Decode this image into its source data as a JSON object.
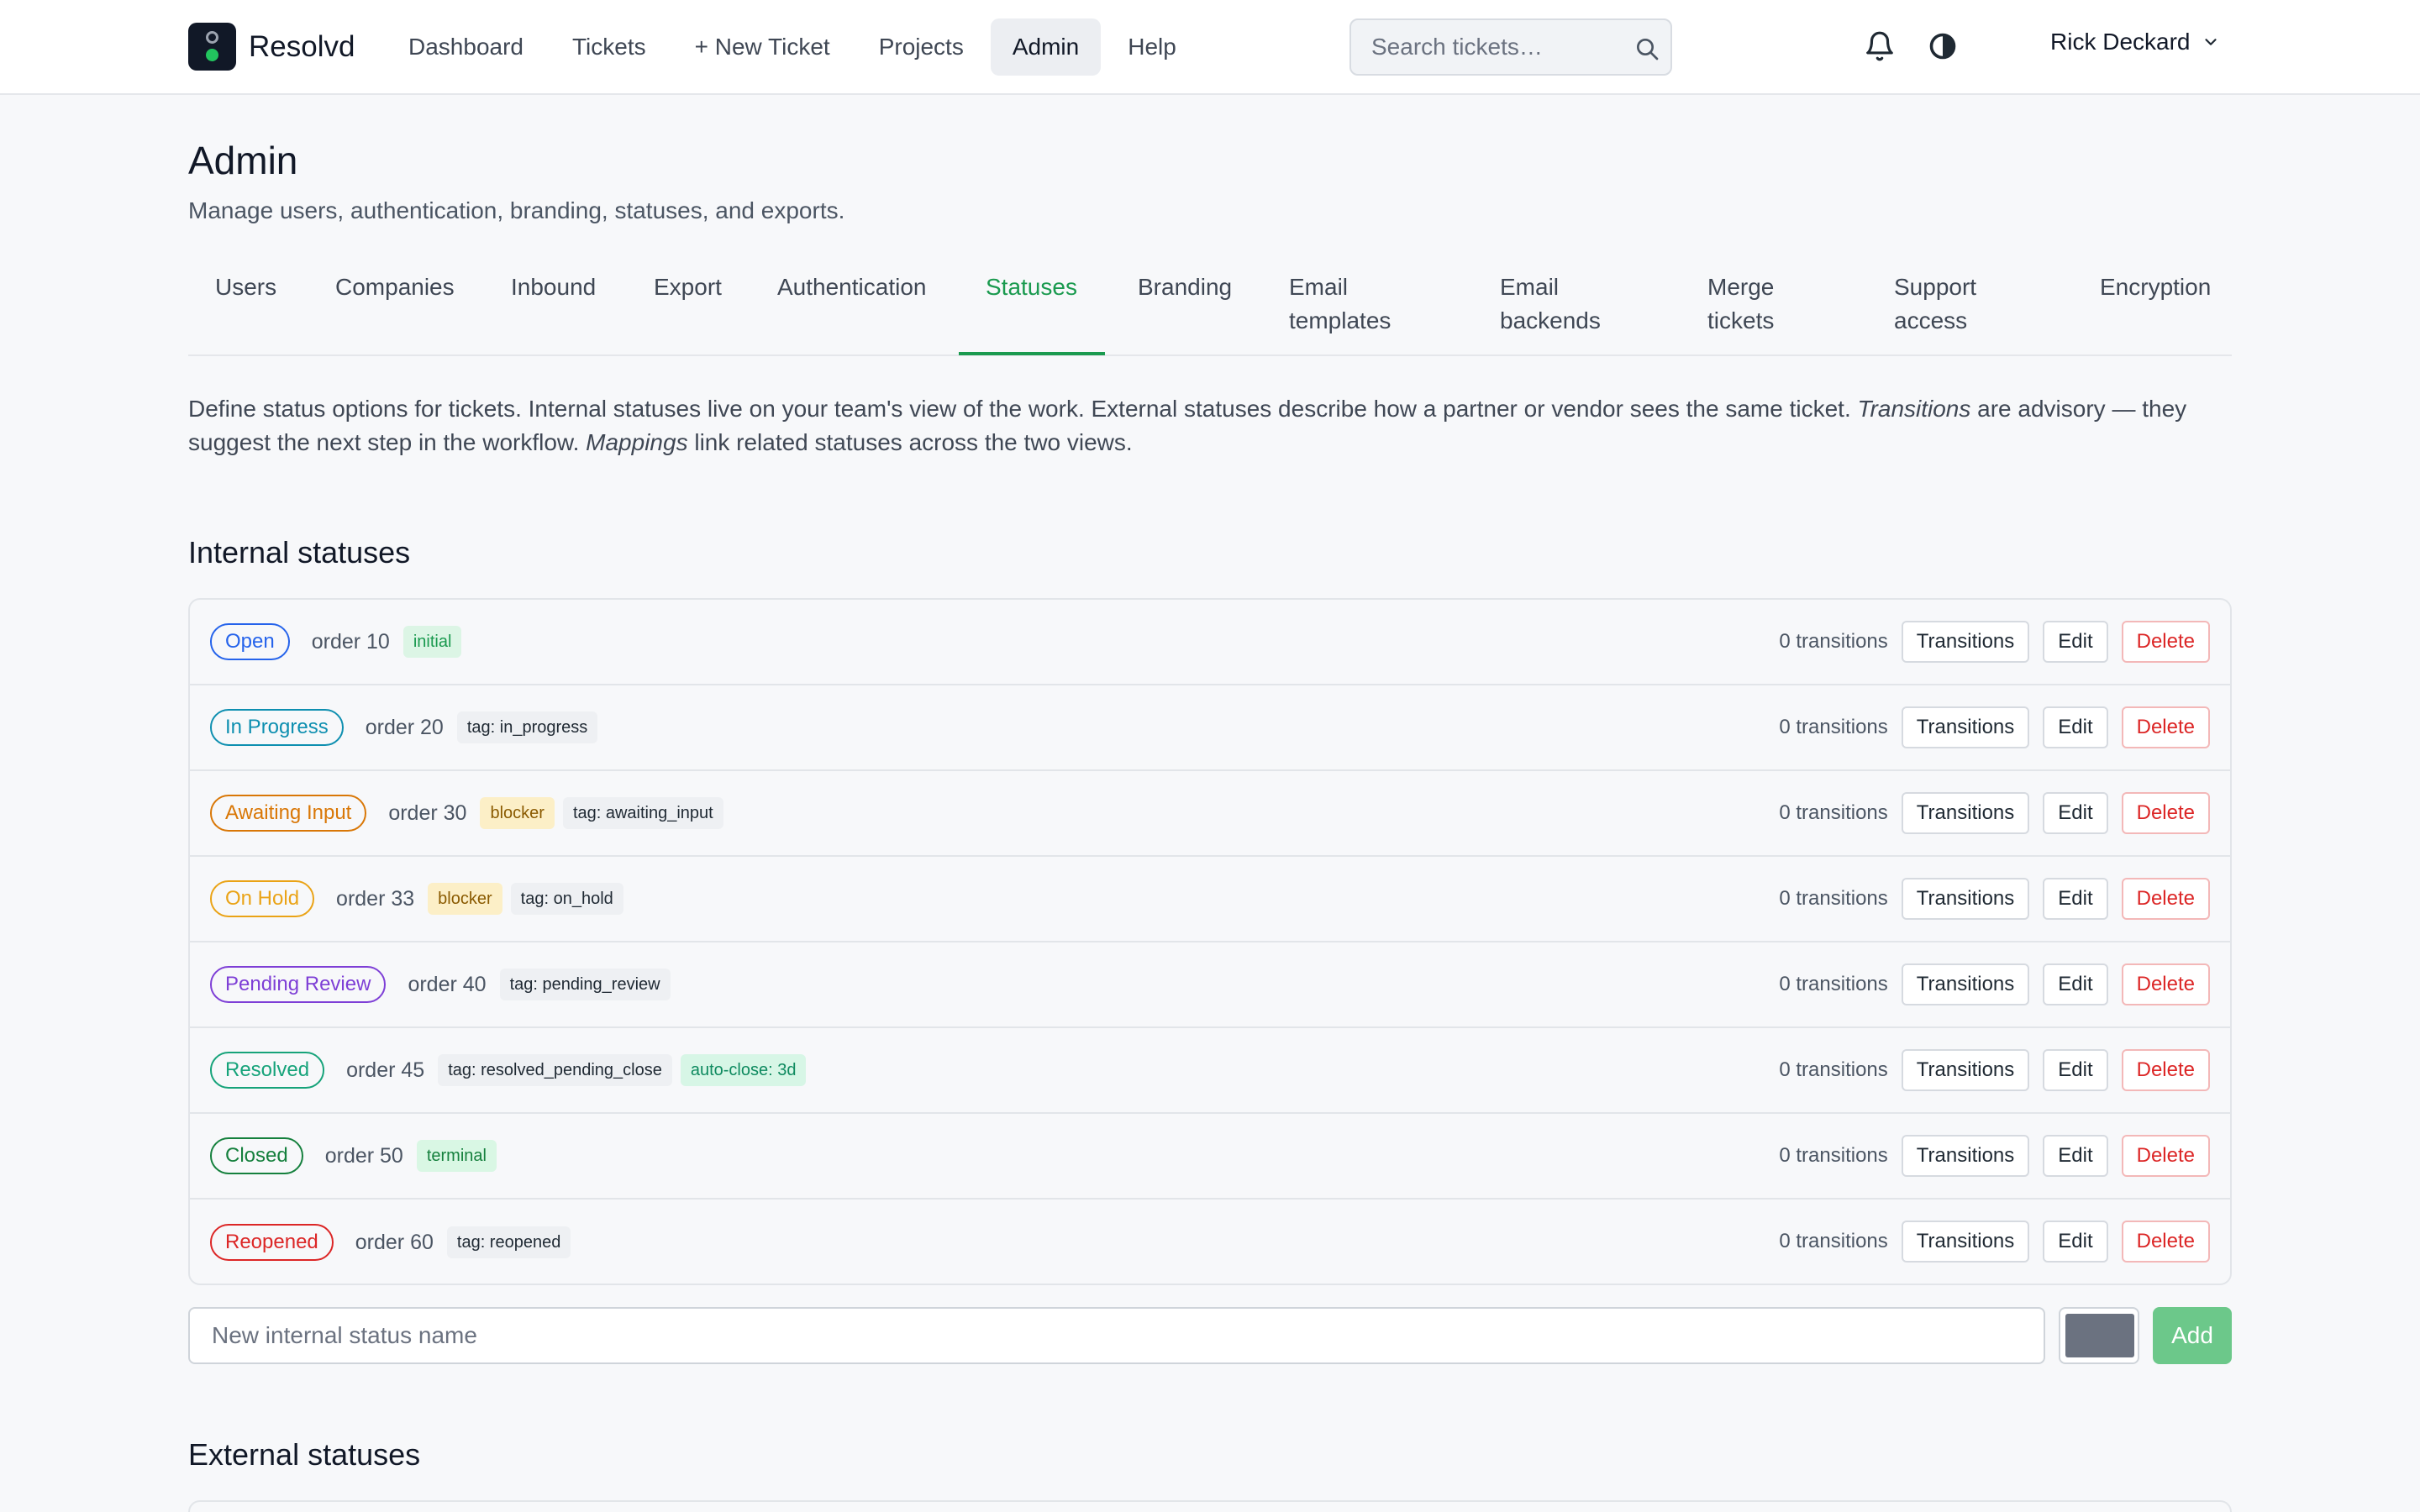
{
  "app": {
    "name": "Resolvd"
  },
  "nav": [
    {
      "label": "Dashboard",
      "active": false
    },
    {
      "label": "Tickets",
      "active": false
    },
    {
      "label": "+ New Ticket",
      "active": false
    },
    {
      "label": "Projects",
      "active": false
    },
    {
      "label": "Admin",
      "active": true
    },
    {
      "label": "Help",
      "active": false
    }
  ],
  "search": {
    "placeholder": "Search tickets…",
    "icon": "search-icon"
  },
  "user": {
    "name": "Rick Deckard"
  },
  "page": {
    "title": "Admin",
    "subtitle": "Manage users, authentication, branding, statuses, and exports."
  },
  "tabs": [
    {
      "label": "Users",
      "active": false
    },
    {
      "label": "Companies",
      "active": false
    },
    {
      "label": "Inbound",
      "active": false
    },
    {
      "label": "Export",
      "active": false
    },
    {
      "label": "Authentication",
      "active": false
    },
    {
      "label": "Statuses",
      "active": true
    },
    {
      "label": "Branding",
      "active": false
    },
    {
      "label": "Email templates",
      "active": false
    },
    {
      "label": "Email backends",
      "active": false
    },
    {
      "label": "Merge tickets",
      "active": false
    },
    {
      "label": "Support access",
      "active": false
    },
    {
      "label": "Encryption",
      "active": false
    }
  ],
  "intro": {
    "part1": "Define status options for tickets. Internal statuses live on your team's view of the work. External statuses describe how a partner or vendor sees the same ticket. ",
    "em1": "Transitions",
    "part2": " are advisory — they suggest the next step in the workflow. ",
    "em2": "Mappings",
    "part3": " link related statuses across the two views."
  },
  "internal": {
    "title": "Internal statuses",
    "statuses": [
      {
        "name": "Open",
        "color": "#2563eb",
        "order": "order 10",
        "badges": [
          {
            "text": "initial",
            "type": "initial"
          }
        ],
        "transitions": "0 transitions"
      },
      {
        "name": "In Progress",
        "color": "#0e8fb0",
        "order": "order 20",
        "badges": [
          {
            "text": "tag: in_progress",
            "type": "tag"
          }
        ],
        "transitions": "0 transitions"
      },
      {
        "name": "Awaiting Input",
        "color": "#d97706",
        "order": "order 30",
        "badges": [
          {
            "text": "blocker",
            "type": "blocker"
          },
          {
            "text": "tag: awaiting_input",
            "type": "tag"
          }
        ],
        "transitions": "0 transitions"
      },
      {
        "name": "On Hold",
        "color": "#eaa316",
        "order": "order 33",
        "badges": [
          {
            "text": "blocker",
            "type": "blocker"
          },
          {
            "text": "tag: on_hold",
            "type": "tag"
          }
        ],
        "transitions": "0 transitions"
      },
      {
        "name": "Pending Review",
        "color": "#7e3fd6",
        "order": "order 40",
        "badges": [
          {
            "text": "tag: pending_review",
            "type": "tag"
          }
        ],
        "transitions": "0 transitions"
      },
      {
        "name": "Resolved",
        "color": "#16a37a",
        "order": "order 45",
        "badges": [
          {
            "text": "tag: resolved_pending_close",
            "type": "tag"
          },
          {
            "text": "auto-close: 3d",
            "type": "autoclose"
          }
        ],
        "transitions": "0 transitions"
      },
      {
        "name": "Closed",
        "color": "#15803d",
        "order": "order 50",
        "badges": [
          {
            "text": "terminal",
            "type": "terminal"
          }
        ],
        "transitions": "0 transitions"
      },
      {
        "name": "Reopened",
        "color": "#dc2626",
        "order": "order 60",
        "badges": [
          {
            "text": "tag: reopened",
            "type": "tag"
          }
        ],
        "transitions": "0 transitions"
      }
    ],
    "actions": {
      "transitions": "Transitions",
      "edit": "Edit",
      "delete": "Delete"
    },
    "new_placeholder": "New internal status name",
    "new_color": "#6b7280",
    "add_label": "Add"
  },
  "external": {
    "title": "External statuses"
  }
}
